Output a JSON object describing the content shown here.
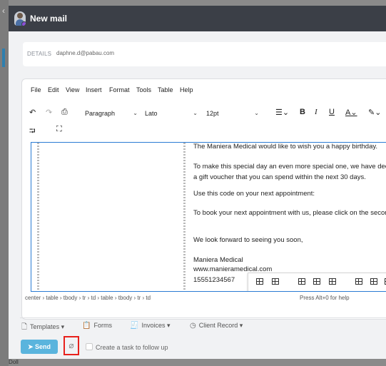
{
  "window": {
    "title": "New mail"
  },
  "details": {
    "label": "DETAILS",
    "email": "daphne.d@pabau.com"
  },
  "menu": [
    "File",
    "Edit",
    "View",
    "Insert",
    "Format",
    "Tools",
    "Table",
    "Help"
  ],
  "toolbar": {
    "block_format": "Paragraph",
    "font_family": "Lato",
    "font_size": "12pt"
  },
  "body_lines": [
    "The Maniera Medical would like to wish you a happy birthday.",
    "To make this special day an even more special one, we have decide",
    "a gift voucher that you can spend within the next 30 days.",
    "Use this code on your next appointment:",
    "To book your next appointment with us, please click on the second",
    "We look forward to seeing you soon,",
    "Maniera Medical",
    "www.manieramedical.com",
    "15551234567"
  ],
  "statusbar": {
    "path": "center › table › tbody › tr › td › table › tbody › tr › td",
    "help": "Press Alt+0 for help"
  },
  "footer": {
    "templates": "Templates",
    "forms": "Forms",
    "invoices": "Invoices",
    "client_record": "Client Record",
    "send": "Send",
    "task_label": "Create a task to follow up"
  },
  "background": {
    "fragment": "Doll"
  },
  "colors": {
    "titlebar": "#3b3f47",
    "send": "#5ab4dd",
    "focus": "#2b7cd3",
    "highlight": "#e8211c"
  }
}
